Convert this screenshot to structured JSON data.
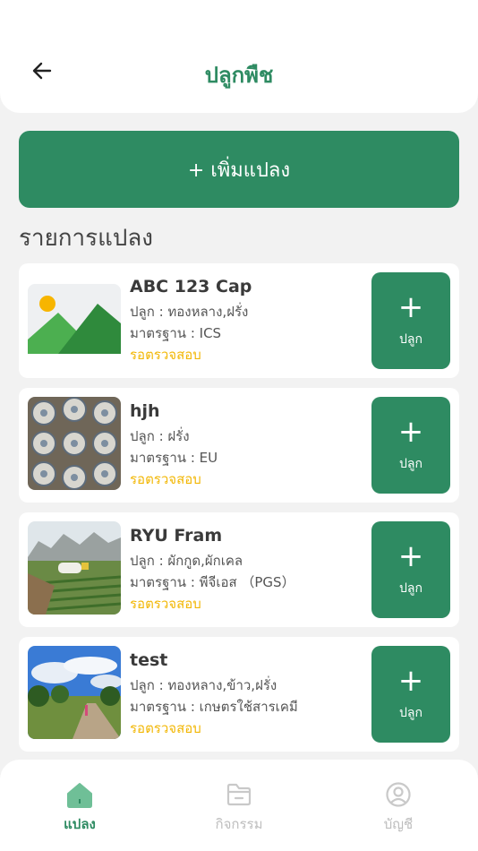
{
  "header": {
    "title": "ปลูกพืช",
    "back_icon": "arrow-left-icon"
  },
  "add_plot_label": "+ เพิ่มแปลง",
  "section_title": "รายการแปลง",
  "colors": {
    "primary": "#2e8b62",
    "status": "#f2b705"
  },
  "plots": [
    {
      "name": "ABC 123 Cap",
      "crop": "ปลูก : ทองหลาง,ฝรั่ง",
      "standard": "มาตรฐาน : ICS",
      "status": "รอตรวจสอบ",
      "button_label": "ปลูก",
      "image": "placeholder-image-icon"
    },
    {
      "name": "hjh",
      "crop": "ปลูก : ฝรั่ง",
      "standard": "มาตรฐาน : EU",
      "status": "รอตรวจสอบ",
      "button_label": "ปลูก",
      "image": "tile-pattern-photo"
    },
    {
      "name": "RYU Fram",
      "crop": "ปลูก : ผักกูด,ผักเคล",
      "standard": "มาตรฐาน : พีจีเอส （PGS）",
      "status": "รอตรวจสอบ",
      "button_label": "ปลูก",
      "image": "farm-photo"
    },
    {
      "name": "test",
      "crop": "ปลูก : ทองหลาง,ข้าว,ฝรั่ง",
      "standard": "มาตรฐาน : เกษตรใช้สารเคมี",
      "status": "รอตรวจสอบ",
      "button_label": "ปลูก",
      "image": "field-photo"
    }
  ],
  "nav": [
    {
      "label": "แปลง",
      "icon": "home-icon",
      "active": true
    },
    {
      "label": "กิจกรรม",
      "icon": "folder-icon",
      "active": false
    },
    {
      "label": "บัญชี",
      "icon": "user-circle-icon",
      "active": false
    }
  ]
}
